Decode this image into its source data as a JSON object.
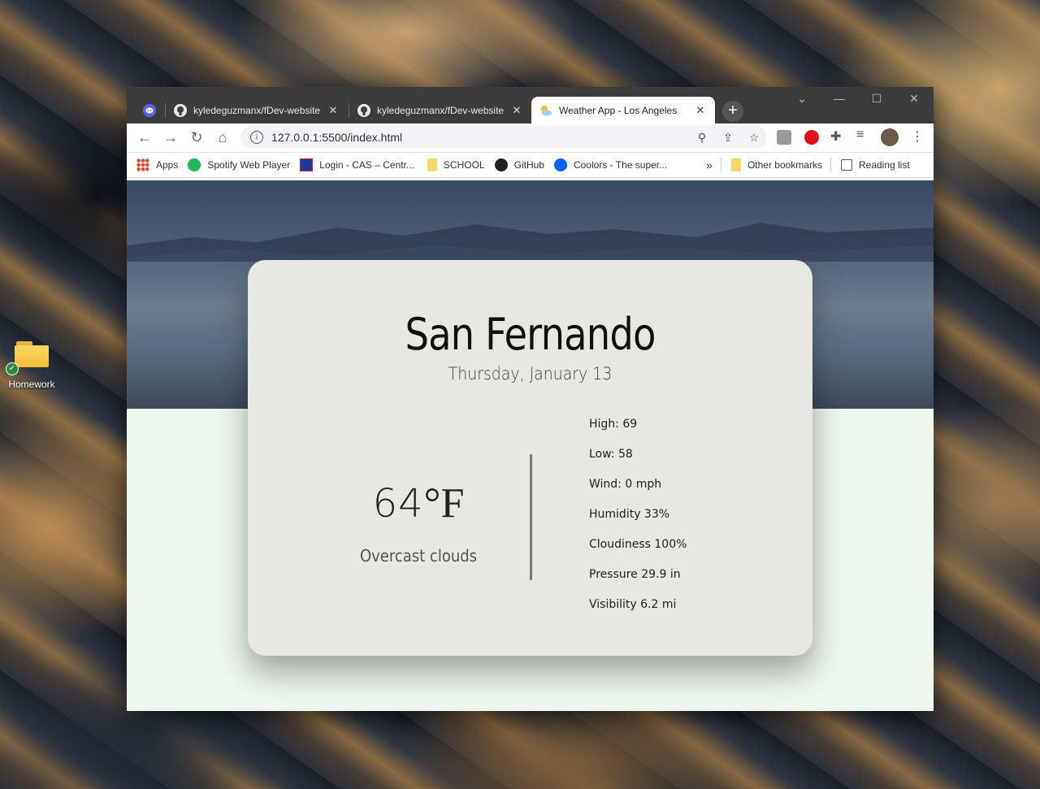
{
  "desktop": {
    "folder_label": "Homework"
  },
  "tabs": [
    {
      "title": "",
      "icon": "discord-icon"
    },
    {
      "title": "kyledeguzmanx/fDev-website",
      "icon": "github-icon"
    },
    {
      "title": "kyledeguzmanx/fDev-website",
      "icon": "github-icon"
    },
    {
      "title": "Weather App - Los Angeles",
      "icon": "weather-icon"
    }
  ],
  "address": {
    "url": "127.0.0.1:5500/index.html"
  },
  "bookmarks": {
    "apps": "Apps",
    "spotify": "Spotify Web Player",
    "login": "Login - CAS – Centr...",
    "school": "SCHOOL",
    "github": "GitHub",
    "coolors": "Coolors - The super...",
    "more": "»",
    "other": "Other bookmarks",
    "reading": "Reading list"
  },
  "weather": {
    "city": "San Fernando",
    "date": "Thursday, January 13",
    "temp_value": "64",
    "temp_unit": "°F",
    "description": "Overcast clouds",
    "stats": [
      "High: 69",
      "Low: 58",
      "Wind: 0 mph",
      "Humidity 33%",
      "Cloudiness 100%",
      "Pressure 29.9 in",
      "Visibility 6.2 mi"
    ]
  },
  "colors": {
    "tabstrip": "#3c3c3c",
    "card": "#e8e8e3",
    "page_bg": "#eef7ee",
    "discord": "#5865f2"
  }
}
